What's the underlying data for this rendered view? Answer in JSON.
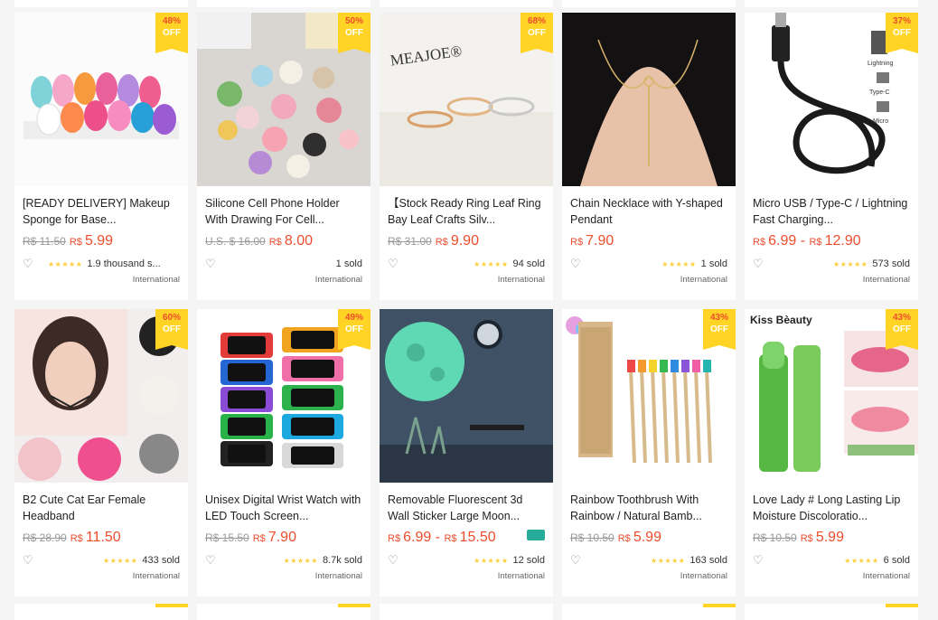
{
  "badge_off_label": "OFF",
  "international_label": "International",
  "products": [
    {
      "title": "[READY DELIVERY] Makeup Sponge for Base...",
      "old_price": "R$ 11.50",
      "price": "5.99",
      "price_max": "",
      "discount": "48%",
      "rating_stars": "★★★★★",
      "sold": "1.9 thousand s...",
      "truck": false
    },
    {
      "title": "Silicone Cell Phone Holder With Drawing For Cell...",
      "old_price": "U.S. $ 16.00",
      "price": "8.00",
      "price_max": "",
      "discount": "50%",
      "rating_stars": "",
      "sold": "1 sold",
      "truck": false
    },
    {
      "title": "【Stock Ready Ring Leaf Ring Bay Leaf Crafts Silv...",
      "old_price": "R$ 31.00",
      "price": "9.90",
      "price_max": "",
      "discount": "68%",
      "rating_stars": "★★★★★",
      "sold": "94 sold",
      "truck": false
    },
    {
      "title": "Chain Necklace with Y-shaped Pendant",
      "old_price": "",
      "price": "7.90",
      "price_max": "",
      "discount": "",
      "rating_stars": "★★★★★",
      "sold": "1 sold",
      "truck": false
    },
    {
      "title": "Micro USB / Type-C / Lightning Fast Charging...",
      "old_price": "",
      "price": "6.99",
      "price_max": "12.90",
      "discount": "37%",
      "rating_stars": "★★★★★",
      "sold": "573 sold",
      "truck": false
    },
    {
      "title": "B2 Cute Cat Ear Female Headband",
      "old_price": "R$ 28.90",
      "price": "11.50",
      "price_max": "",
      "discount": "60%",
      "rating_stars": "★★★★★",
      "sold": "433 sold",
      "truck": false
    },
    {
      "title": "Unisex Digital Wrist Watch with LED Touch Screen...",
      "old_price": "R$ 15.50",
      "price": "7.90",
      "price_max": "",
      "discount": "49%",
      "rating_stars": "★★★★★",
      "sold": "8.7k sold",
      "truck": false
    },
    {
      "title": "Removable Fluorescent 3d Wall Sticker Large Moon...",
      "old_price": "",
      "price": "6.99",
      "price_max": "15.50",
      "discount": "",
      "rating_stars": "★★★★★",
      "sold": "12 sold",
      "truck": true
    },
    {
      "title": "Rainbow Toothbrush With Rainbow / Natural Bamb...",
      "old_price": "R$ 10.50",
      "price": "5.99",
      "price_max": "",
      "discount": "43%",
      "rating_stars": "★★★★★",
      "sold": "163 sold",
      "truck": false
    },
    {
      "title": "Love Lady # Long Lasting Lip Moisture Discoloratio...",
      "old_price": "R$ 10.50",
      "price": "5.99",
      "price_max": "",
      "discount": "43%",
      "rating_stars": "★★★★★",
      "sold": "6 sold",
      "truck": false
    }
  ],
  "image_text": {
    "meajoe": "MEAJOE®",
    "kiss_beauty": "Kiss Bèauty",
    "lightning": "Lightning",
    "type_c": "Type-C",
    "micro": "Micro"
  },
  "colors": {
    "price": "#ee4d2d",
    "badge_bg": "#ffd424",
    "stars": "#ffce3d"
  }
}
